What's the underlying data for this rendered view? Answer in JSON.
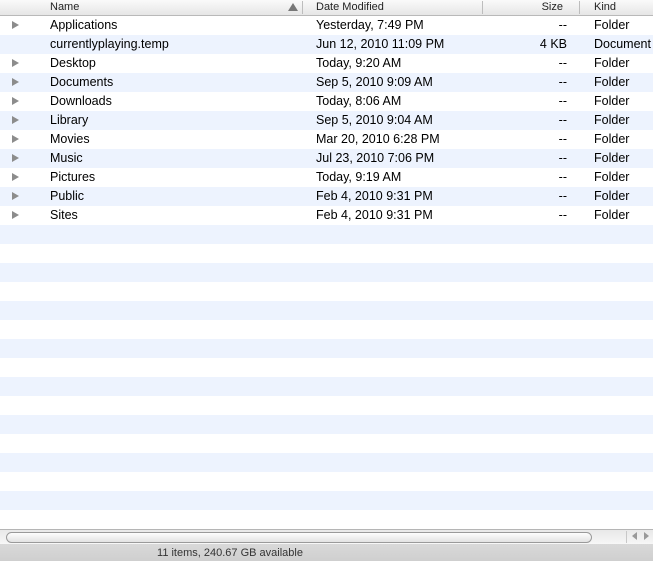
{
  "columns": {
    "name": "Name",
    "date_modified": "Date Modified",
    "size": "Size",
    "kind": "Kind"
  },
  "files": [
    {
      "name": "Applications",
      "date": "Yesterday, 7:49 PM",
      "size": "--",
      "kind": "Folder",
      "expandable": true
    },
    {
      "name": "currentlyplaying.temp",
      "date": "Jun 12, 2010 11:09 PM",
      "size": "4 KB",
      "kind": "Document",
      "expandable": false
    },
    {
      "name": "Desktop",
      "date": "Today, 9:20 AM",
      "size": "--",
      "kind": "Folder",
      "expandable": true
    },
    {
      "name": "Documents",
      "date": "Sep 5, 2010 9:09 AM",
      "size": "--",
      "kind": "Folder",
      "expandable": true
    },
    {
      "name": "Downloads",
      "date": "Today, 8:06 AM",
      "size": "--",
      "kind": "Folder",
      "expandable": true
    },
    {
      "name": "Library",
      "date": "Sep 5, 2010 9:04 AM",
      "size": "--",
      "kind": "Folder",
      "expandable": true
    },
    {
      "name": "Movies",
      "date": "Mar 20, 2010 6:28 PM",
      "size": "--",
      "kind": "Folder",
      "expandable": true
    },
    {
      "name": "Music",
      "date": "Jul 23, 2010 7:06 PM",
      "size": "--",
      "kind": "Folder",
      "expandable": true
    },
    {
      "name": "Pictures",
      "date": "Today, 9:19 AM",
      "size": "--",
      "kind": "Folder",
      "expandable": true
    },
    {
      "name": "Public",
      "date": "Feb 4, 2010 9:31 PM",
      "size": "--",
      "kind": "Folder",
      "expandable": true
    },
    {
      "name": "Sites",
      "date": "Feb 4, 2010 9:31 PM",
      "size": "--",
      "kind": "Folder",
      "expandable": true
    }
  ],
  "sort": {
    "column": "Name",
    "direction": "ascending",
    "icon": "sort-ascending-icon"
  },
  "status": {
    "text": "11 items, 240.67 GB available"
  },
  "colors": {
    "stripe": "#edf3fe",
    "background": "#ffffff"
  }
}
